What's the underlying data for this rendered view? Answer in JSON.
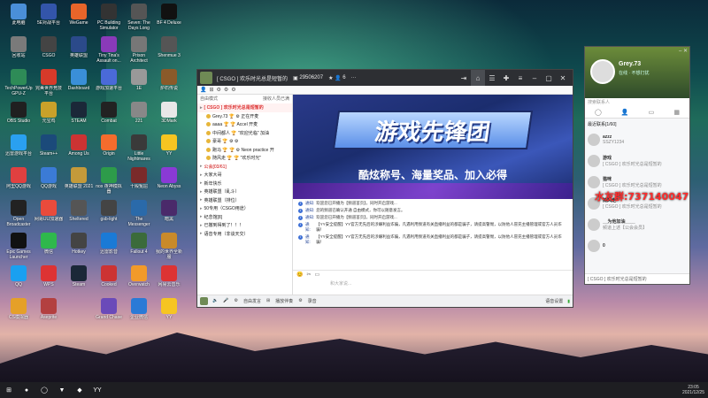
{
  "desktop": {
    "icons": [
      {
        "label": "此电脑",
        "color": "#4a8fd8"
      },
      {
        "label": "回收站",
        "color": "#7a7a7a"
      },
      {
        "label": "TechPowerUp GPU-Z",
        "color": "#2e8b57"
      },
      {
        "label": "OBS Studio",
        "color": "#202020"
      },
      {
        "label": "迅雷游戏平台",
        "color": "#2aa0f0"
      },
      {
        "label": "阿里QQ游戏",
        "color": "#e04040"
      },
      {
        "label": "Open Broadcaster",
        "color": "#222"
      },
      {
        "label": "Epic Games Launcher",
        "color": "#111"
      },
      {
        "label": "QQ",
        "color": "#1aa0f0"
      },
      {
        "label": "CS模拟器",
        "color": "#e5a028"
      },
      {
        "label": "5E对战平台",
        "color": "#3355aa"
      },
      {
        "label": "CSGO",
        "color": "#444"
      },
      {
        "label": "完美世界竞技平台",
        "color": "#d63a2a"
      },
      {
        "label": "元宝鸡",
        "color": "#c9a12a"
      },
      {
        "label": "Steam++",
        "color": "#1b4a7a"
      },
      {
        "label": "QQ游戏",
        "color": "#3b7bd6"
      },
      {
        "label": "网易UU加速器",
        "color": "#e94b3c"
      },
      {
        "label": "微信",
        "color": "#2fb84c"
      },
      {
        "label": "WPS",
        "color": "#d33"
      },
      {
        "label": "Aseprite",
        "color": "#b34040"
      },
      {
        "label": "WeGame",
        "color": "#e8652a"
      },
      {
        "label": "英雄联盟",
        "color": "#2b4a8a"
      },
      {
        "label": "Dashboard",
        "color": "#3a8fd8"
      },
      {
        "label": "STEAM",
        "color": "#1b2838"
      },
      {
        "label": "Among Us",
        "color": "#c33"
      },
      {
        "label": "英雄联盟 2021",
        "color": "#c49a3a"
      },
      {
        "label": "Sheltered",
        "color": "#555"
      },
      {
        "label": "Hotkey",
        "color": "#444"
      },
      {
        "label": "Steam",
        "color": "#1b2838"
      },
      {
        "label": "PC Building Simulator",
        "color": "#333"
      },
      {
        "label": "Tiny Tina's Assault on...",
        "color": "#8a3ab9"
      },
      {
        "label": "游戏加速平台",
        "color": "#4a6ad8"
      },
      {
        "label": "Combat",
        "color": "#222"
      },
      {
        "label": "Origin",
        "color": "#f56c2d"
      },
      {
        "label": "nox 夜神模拟器",
        "color": "#2d9b4a"
      },
      {
        "label": "gsb-light",
        "color": "#444"
      },
      {
        "label": "迅雷影音",
        "color": "#1a7ad6"
      },
      {
        "label": "Cooked",
        "color": "#c33"
      },
      {
        "label": "Grand Chase",
        "color": "#6a4ab9"
      },
      {
        "label": "Seven: The Days Long Gone",
        "color": "#555"
      },
      {
        "label": "Prison Architect",
        "color": "#777"
      },
      {
        "label": "1E",
        "color": "#999"
      },
      {
        "label": "221",
        "color": "#888"
      },
      {
        "label": "Little Nightmares",
        "color": "#3a3a3a"
      },
      {
        "label": "十殿冤屈",
        "color": "#7a2a2a"
      },
      {
        "label": "The Messenger",
        "color": "#2a6aaa"
      },
      {
        "label": "Fallout 4",
        "color": "#3b6b3b"
      },
      {
        "label": "Overwatch",
        "color": "#f29a2a"
      },
      {
        "label": "企业微信",
        "color": "#2a7ad6"
      },
      {
        "label": "BF 4 Deluxe",
        "color": "#111"
      },
      {
        "label": "Shenmue 3",
        "color": "#555"
      },
      {
        "label": "炉石传说",
        "color": "#8a5a2a"
      },
      {
        "label": "3DMark",
        "color": "#e8e8e8"
      },
      {
        "label": "YY",
        "color": "#f6c521"
      },
      {
        "label": "Neon Abyss",
        "color": "#8a3ad6"
      },
      {
        "label": "暗黑",
        "color": "#4a2a6a"
      },
      {
        "label": "我的世界全新服",
        "color": "#c98a2a"
      },
      {
        "label": "网易云音乐",
        "color": "#d33"
      },
      {
        "label": "YY",
        "color": "#f6c521"
      }
    ]
  },
  "window": {
    "title": "[ CSGO ] 欢乐时光总是短暂的",
    "channel_id": "29506207",
    "user_count": "6",
    "mode_label": "自由模式",
    "mode_right": "接收人员已满",
    "toolbar2": [
      "👤",
      "⊞",
      "⚙",
      "⚙",
      "⚙"
    ],
    "channels": [
      {
        "text": "[ CSGO ] 欢乐时光总是短暂的",
        "cls": "root"
      },
      {
        "text": "Grey.73  🏆 ⚙  正在开麦",
        "cls": "sub"
      },
      {
        "text": "aaaa  🏆 🏆  Accel 开麦",
        "cls": "sub"
      },
      {
        "text": "中间都人 🏆 \"欢迎光临\" 加油",
        "cls": "sub"
      },
      {
        "text": "豪哥 🏆 ⚙ ⚙",
        "cls": "sub"
      },
      {
        "text": "跑马 🏆 🏆 ⚙  Neon practice 开",
        "cls": "sub"
      },
      {
        "text": "随风走 🏆 🏆  \"欢乐时光\"",
        "cls": "sub"
      },
      {
        "text": "公会[03/61]",
        "cls": "hl"
      },
      {
        "text": "大家大哥",
        "cls": ""
      },
      {
        "text": "新年快乐",
        "cls": ""
      },
      {
        "text": "英雄联盟（乱斗）",
        "cls": ""
      },
      {
        "text": "英雄联盟（排位）",
        "cls": ""
      },
      {
        "text": "50专用（CSGO用途）",
        "cls": ""
      },
      {
        "text": "纪念馆[8]",
        "cls": ""
      },
      {
        "text": "已撤到得到了！！！",
        "cls": ""
      },
      {
        "text": "语音专用（非谈天交）",
        "cls": ""
      }
    ],
    "banner_title": "游戏先锋团",
    "banner_sub": "酷炫称号、海量奖品、加入必得",
    "messages": [
      {
        "tag": "通知:",
        "text": "欢迎您已开播为【频道首页】，同时开启游戏..."
      },
      {
        "tag": "通知:",
        "text": "您的频道已确认开通 自由模式，你可以随意发言。"
      },
      {
        "tag": "通知:",
        "text": "欢迎您已开播为【频道首页】，同时开启游戏..."
      },
      {
        "tag": "通知:",
        "text": "【YY安全提醒】YY官方无先后的涉嫌利益诈骗，凡遇利用频道有关直播利益的都是骗子，请提高警惕，以防他人冒充主播管理或官方人员诈骗！"
      },
      {
        "tag": "通知:",
        "text": "【YY安全提醒】YY官方无先后的涉嫌利益诈骗，凡遇利用频道有关直播利益的都是骗子，请提高警惕，以防他人冒充主播管理或官方人员诈骗！"
      }
    ],
    "input_placeholder": "和大家说...",
    "input_tools": [
      "😊",
      "✂",
      "▭"
    ],
    "status": [
      "🔈",
      "🎤",
      "⚙",
      "自由发言",
      "⊞",
      "播放伴奏",
      "⚙",
      "录音"
    ],
    "status_right": "语音设置"
  },
  "right_panel": {
    "username": "Grey.73",
    "status_sub": "在线 · 不想打扰",
    "search_placeholder": "搜索联系人",
    "tabs": [
      "◯",
      "👤",
      "▭",
      "▦"
    ],
    "header": "最近联系[1/60]",
    "contacts": [
      {
        "name": "azzz",
        "desc": "SSZY1234"
      },
      {
        "name": "游戏",
        "desc": "[ CSGO ] 欢乐时光总是短暂的"
      },
      {
        "name": "猫咪",
        "desc": "[ CSGO ] 欢乐时光总是短暂的"
      },
      {
        "name": "随风走",
        "desc": "[ CSGO ] 欢乐时光总是短暂的"
      },
      {
        "name": "__为他加油____",
        "desc": "频道上述【公会会员】"
      },
      {
        "name": "0",
        "desc": ""
      }
    ],
    "bottom": "[ CSGO ] 欢乐时光总是短暂的",
    "promo": "水友群:737140047"
  },
  "taskbar": {
    "items": [
      "⊞",
      "●",
      "◯",
      "▼",
      "◆",
      "YY"
    ],
    "time": "23:05",
    "date": "2021/12/25"
  }
}
